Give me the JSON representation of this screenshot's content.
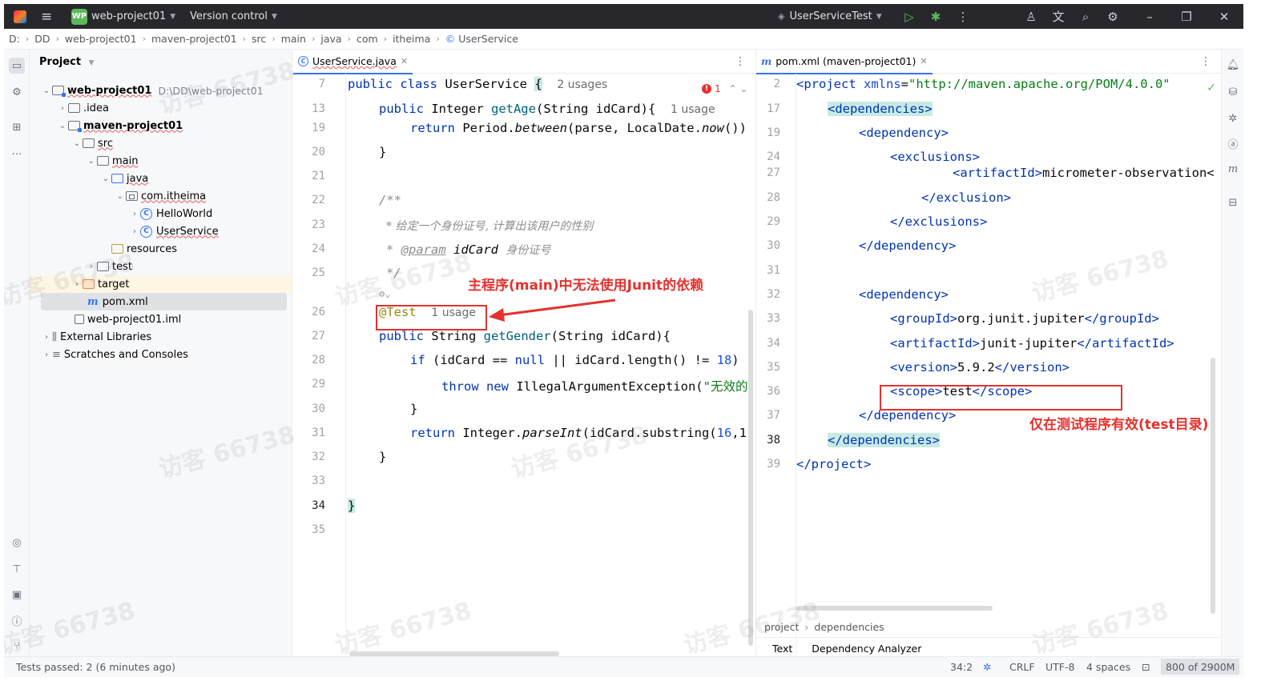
{
  "titlebar": {
    "project_badge": "WP",
    "project_name": "web-project01",
    "version_control": "Version control",
    "run_config": "UserServiceTest"
  },
  "breadcrumb": [
    "D:",
    "DD",
    "web-project01",
    "maven-project01",
    "src",
    "main",
    "java",
    "com",
    "itheima",
    "UserService"
  ],
  "project_panel": {
    "title": "Project",
    "tree": [
      {
        "label": "web-project01",
        "hint": "D:\\DD\\web-project01"
      },
      {
        "label": ".idea"
      },
      {
        "label": "maven-project01"
      },
      {
        "label": "src"
      },
      {
        "label": "main"
      },
      {
        "label": "java"
      },
      {
        "label": "com.itheima"
      },
      {
        "label": "HelloWorld"
      },
      {
        "label": "UserService"
      },
      {
        "label": "resources"
      },
      {
        "label": "test"
      },
      {
        "label": "target"
      },
      {
        "label": "pom.xml"
      },
      {
        "label": "web-project01.iml"
      },
      {
        "label": "External Libraries"
      },
      {
        "label": "Scratches and Consoles"
      }
    ]
  },
  "left_editor": {
    "tab": "UserService.java",
    "error_count": "1",
    "line_numbers": [
      "7",
      "13",
      "19",
      "20",
      "21",
      "22",
      "23",
      "24",
      "25",
      "",
      "26",
      "27",
      "28",
      "29",
      "30",
      "31",
      "32",
      "33",
      "34",
      "35"
    ],
    "lines": {
      "l7_kw": "public class ",
      "l7_name": "UserService ",
      "l7_brace": "{",
      "l7_hint": "2 usages",
      "l13_kw": "public ",
      "l13_a": "Integer ",
      "l13_fn": "getAge",
      "l13_b": "(String idCard){",
      "l13_hint": "1 usage",
      "l19_kw": "return ",
      "l19_a": "Period.",
      "l19_it": "between",
      "l19_b": "(parse, LocalDate.",
      "l19_it2": "now",
      "l19_c": "())",
      "l20": "}",
      "l22": "/**",
      "l23": "* 给定一个身份证号, 计算出该用户的性别",
      "l24_a": "* ",
      "l24_tag": "@param",
      "l24_b": " idCard ",
      "l24_c": "身份证号",
      "l25": "*/",
      "l26_ann": "@Test",
      "l26_hint": "1 usage",
      "l27_kw": "public ",
      "l27_a": "String ",
      "l27_fn": "getGender",
      "l27_b": "(String idCard){",
      "l28_kw": "if ",
      "l28_a": "(idCard == ",
      "l28_kw2": "null",
      "l28_b": " || idCard.length() != ",
      "l28_num": "18",
      "l28_c": ")",
      "l29_kw": "throw new ",
      "l29_a": "IllegalArgumentException(",
      "l29_str": "\"无效的",
      "l30": "}",
      "l31_kw": "return ",
      "l31_a": "Integer.",
      "l31_it": "parseInt",
      "l31_b": "(idCard.substring(",
      "l31_num": "16",
      "l31_c": ",1",
      "l32": "}",
      "l34": "}"
    },
    "annotation": "主程序(main)中无法使用Junit的依赖"
  },
  "right_editor": {
    "tab": "pom.xml (maven-project01)",
    "line_numbers": [
      "2",
      "17",
      "19",
      "24",
      "27",
      "28",
      "29",
      "30",
      "31",
      "32",
      "33",
      "34",
      "35",
      "36",
      "37",
      "38",
      "39"
    ],
    "lines": {
      "l2_a": "<project ",
      "l2_attr": "xmlns",
      "l2_b": "=",
      "l2_str": "\"http://maven.apache.org/POM/4.0.0\"",
      "l17": "<dependencies>",
      "l19": "<dependency>",
      "l24": "<exclusions>",
      "l27_a": "<artifactId>",
      "l27_b": "micrometer-observation<",
      "l28": "</exclusion>",
      "l29": "</exclusions>",
      "l30": "</dependency>",
      "l32": "<dependency>",
      "l33_a": "<groupId>",
      "l33_b": "org.junit.jupiter",
      "l33_c": "</groupId>",
      "l34_a": "<artifactId>",
      "l34_b": "junit-jupiter",
      "l34_c": "</artifactId>",
      "l35_a": "<version>",
      "l35_b": "5.9.2",
      "l35_c": "</version>",
      "l36_a": "<scope>",
      "l36_b": "test",
      "l36_c": "</scope>",
      "l37": "</dependency>",
      "l38": "</dependencies>",
      "l39": "</project>"
    },
    "annotation": "仅在测试程序有效(test目录)",
    "bottom_breadcrumb": [
      "project",
      "dependencies"
    ],
    "bottom_tabs": [
      "Text",
      "Dependency Analyzer"
    ]
  },
  "statusbar": {
    "tests": "Tests passed: 2 (6 minutes ago)",
    "position": "34:2",
    "line_sep": "CRLF",
    "encoding": "UTF-8",
    "indent": "4 spaces",
    "memory": "800 of 2900M"
  },
  "watermark": "访客 66738",
  "colors": {
    "keyword": "#0033b3",
    "annotation_red": "#e5312e",
    "accent": "#3574f0"
  }
}
